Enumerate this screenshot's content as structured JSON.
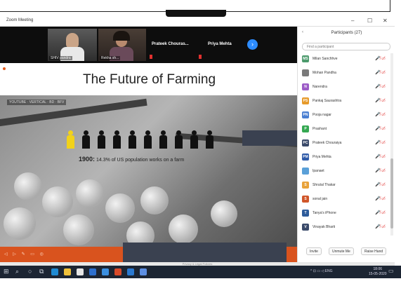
{
  "window": {
    "title": "Zoom Meeting",
    "controls": [
      "–",
      "☐",
      "✕"
    ]
  },
  "video_strip": {
    "thumbs": [
      {
        "name": "SHIV pandra"
      },
      {
        "name": "Rekha sh..."
      }
    ],
    "tiles": [
      {
        "name": "Prateek Chouras..."
      },
      {
        "name": "Priya Mehta"
      }
    ],
    "next_icon": "chevron-right-icon"
  },
  "slide": {
    "title": "The Future of Farming",
    "video_label": "YOUTUBE · VERTICAL · BD · BFV",
    "stat_year": "1900:",
    "stat_text": "14.3% of US population works on a farm"
  },
  "participants": {
    "header": "Participants (27)",
    "search_placeholder": "Find a participant",
    "list": [
      {
        "initials": "MS",
        "name": "Milan Sanchhve",
        "color": "#4c9a6c"
      },
      {
        "initials": "",
        "name": "Mohan Pandha",
        "color": "#7a7a7a"
      },
      {
        "initials": "N",
        "name": "Narendra",
        "color": "#9c5cc7"
      },
      {
        "initials": "PS",
        "name": "Pankaj Saurashtra",
        "color": "#e69a2a"
      },
      {
        "initials": "PN",
        "name": "Pooja nagar",
        "color": "#4a7fd1"
      },
      {
        "initials": "P",
        "name": "Prashant",
        "color": "#35a852"
      },
      {
        "initials": "PC",
        "name": "Prateek Chouraiya",
        "color": "#3a4a6a"
      },
      {
        "initials": "PM",
        "name": "Priya Mehta",
        "color": "#2f5aa8"
      },
      {
        "initials": "",
        "name": "Ipanaet",
        "color": "#5aa0d8"
      },
      {
        "initials": "S",
        "name": "Shrutal Thakar",
        "color": "#e8a23a"
      },
      {
        "initials": "S",
        "name": "sonal jain",
        "color": "#d0562a"
      },
      {
        "initials": "T",
        "name": "Tanya's iPhone",
        "color": "#2d5b9a"
      },
      {
        "initials": "V",
        "name": "Vinayak Bharti",
        "color": "#3a4a6a"
      }
    ],
    "row_icons": "🎤̸ ▭̸",
    "footer": {
      "invite": "Invite",
      "unmute": "Unmute Me",
      "raise_hand": "Raise Hand"
    }
  },
  "privacy_text": "Privacy & Legal Policies",
  "taskbar": {
    "start_icon": "windows-start-icon",
    "search_icon": "search-icon",
    "tray_text": "^ ⊡ ▭ ◁ ENG",
    "time": "18:06",
    "date": "15-05-2020"
  }
}
